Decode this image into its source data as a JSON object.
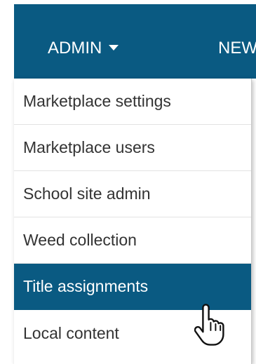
{
  "navbar": {
    "admin_label": "ADMIN",
    "next_label": "NEW"
  },
  "dropdown": {
    "items": [
      {
        "label": "Marketplace settings"
      },
      {
        "label": "Marketplace users"
      },
      {
        "label": "School site admin"
      },
      {
        "label": "Weed collection"
      },
      {
        "label": "Title assignments"
      },
      {
        "label": "Local content"
      }
    ],
    "active_index": 4
  },
  "colors": {
    "nav_background": "#0a5a82",
    "active_item_background": "#0a5a82",
    "item_text": "#333333"
  },
  "icons": {
    "caret": "caret-down-icon",
    "cursor": "hand-pointer-cursor-icon"
  }
}
